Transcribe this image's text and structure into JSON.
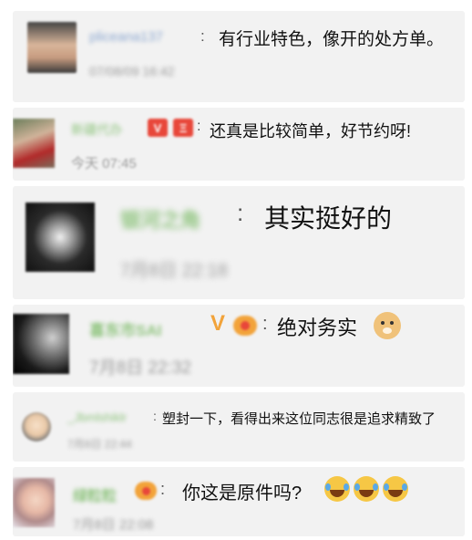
{
  "comments": [
    {
      "username": "pliceana137",
      "message": "有行业特色，像开的处方单。",
      "time": "07/08/09 16:42"
    },
    {
      "username": "新疆代办",
      "message": "还真是比较简单，好节约呀!",
      "time": "今天 07:45"
    },
    {
      "username": "银河之角",
      "message": "其实挺好的",
      "time": "7月8日 22:18"
    },
    {
      "username": "喜东市SAI",
      "message": "绝对务实",
      "time": "7月8日 22:32"
    },
    {
      "username": "_Jbmlshiklr",
      "message": "塑封一下，看得出来这位同志很是追求精致了",
      "time": "7月8日 22:44"
    },
    {
      "username": "绿粒粒",
      "message": "你这是原件吗?",
      "time": "7月8日 22:08"
    }
  ],
  "badges": {
    "v_label": "V",
    "level_label": "Ξ",
    "colon": ":"
  },
  "icons": {
    "verified": "verified-v-icon",
    "level": "level-badge-icon",
    "fans": "fans-badge-icon",
    "dog": "doge-emoji-icon",
    "laugh": "laugh-cry-emoji-icon"
  },
  "colors": {
    "card_bg": "#f2f2f2",
    "username_blue": "#8aa6cf",
    "username_green": "#8fc47e",
    "badge_red": "#e8473a",
    "badge_orange": "#f2a33a",
    "time_gray": "#9a9a9a"
  }
}
